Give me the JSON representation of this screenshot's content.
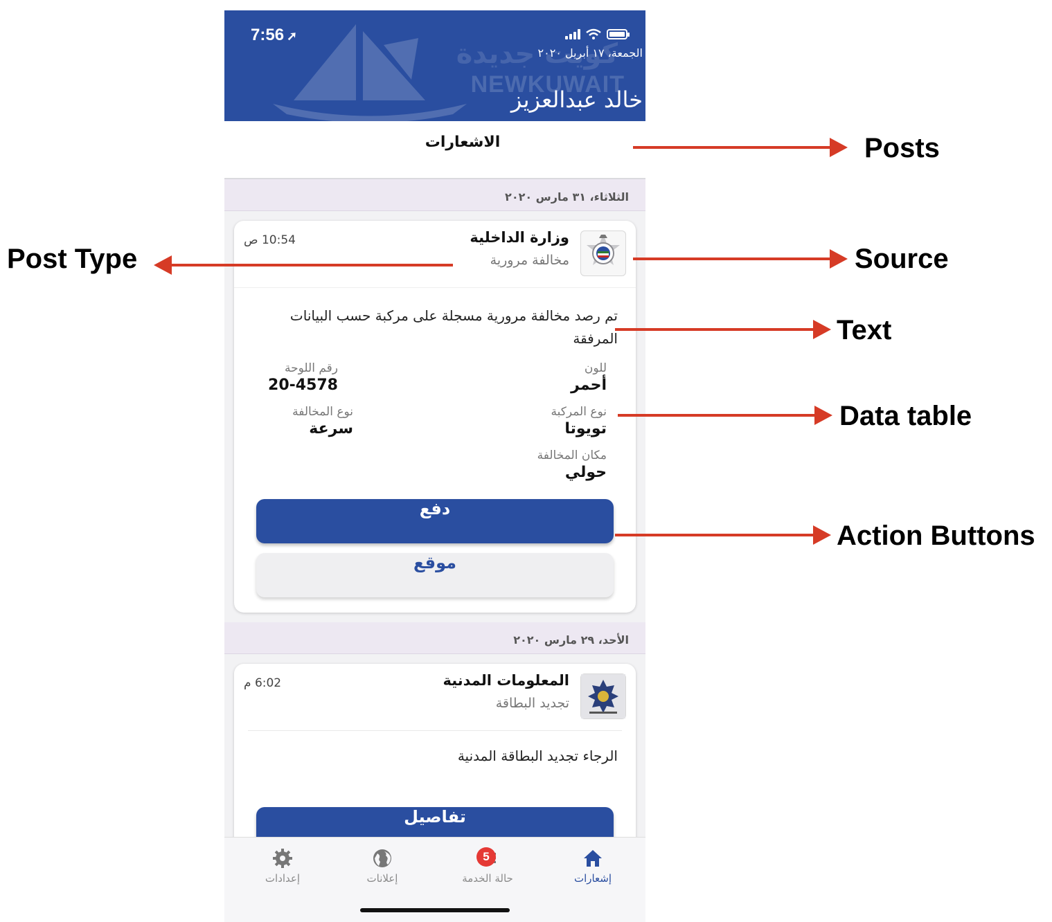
{
  "status_bar": {
    "time": "7:56"
  },
  "header": {
    "date": "الجمعة، ١٧ أبريل ٢٠٢٠",
    "user_name": "خالد عبدالعزيز",
    "watermark": "NEWKUWAIT"
  },
  "posts_title": "الاشعارات",
  "feed": [
    {
      "day": "الثلاثاء، ٣١ مارس ٢٠٢٠",
      "source": "وزارة الداخلية",
      "post_type": "مخالفة مرورية",
      "time": "10:54 ص",
      "logo_icon": "ministry-of-interior-emblem-icon",
      "text": "تم رصد مخالفة مرورية مسجلة على مركبة حسب البيانات المرفقة",
      "data_table": [
        {
          "label": "للون",
          "value": "أحمر"
        },
        {
          "label": "رقم اللوحة",
          "value": "20-4578"
        },
        {
          "label": "نوع المركبة",
          "value": "تويوتا"
        },
        {
          "label": "نوع المخالفة",
          "value": "سرعة"
        },
        {
          "label": "مكان المخالفة",
          "value": "حولي"
        }
      ],
      "actions": {
        "primary": "دفع",
        "secondary": "موقع"
      }
    },
    {
      "day": "الأحد، ٢٩ مارس ٢٠٢٠",
      "source": "المعلومات المدنية",
      "post_type": "تجديد البطاقة",
      "time": "6:02 م",
      "logo_icon": "paci-emblem-icon",
      "text": "الرجاء تجديد البطاقة المدنية",
      "actions": {
        "primary": "تفاصيل"
      }
    }
  ],
  "tabbar": {
    "items": [
      {
        "label": "إشعارات",
        "icon": "home-icon",
        "active": true
      },
      {
        "label": "حالة الخدمة",
        "icon": "list-icon",
        "badge": "5"
      },
      {
        "label": "إعلانات",
        "icon": "globe-icon"
      },
      {
        "label": "إعدادات",
        "icon": "gear-icon"
      }
    ]
  },
  "annotations": {
    "posts": "Posts",
    "post_type": "Post Type",
    "source": "Source",
    "text": "Text",
    "data_table": "Data table",
    "action_buttons": "Action Buttons"
  },
  "colors": {
    "brand": "#2a4ea0",
    "arrow": "#d63b26",
    "badge": "#e53935"
  }
}
